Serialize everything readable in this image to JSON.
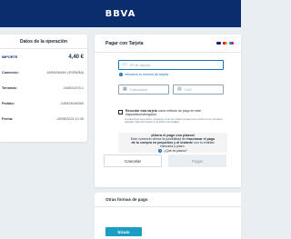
{
  "header": {
    "logo_text": "BBVA"
  },
  "operation": {
    "title": "Datos de la operación",
    "rows": [
      {
        "label": "IMPORTE",
        "value": "4,40 €"
      },
      {
        "label": "Comercio:",
        "value": "JARDINWAY (ESPAÑA)"
      },
      {
        "label": "Terminal:",
        "value": "264031979-1"
      },
      {
        "label": "Pedido:",
        "value": "240829046560"
      },
      {
        "label": "Fecha:",
        "value": "29/08/2024  12:30"
      }
    ]
  },
  "card_payment": {
    "title": "Pagar con Tarjeta",
    "card_number_placeholder": "Nº de tarjeta",
    "card_number_hint": "Introduce tu número de tarjeta",
    "expiry_placeholder": "Caducidad",
    "cvv_placeholder": "CVV",
    "remember_label_bold": "Recordar esta tarjeta",
    "remember_label_rest": "como método de pago en este dispositivo/navegador.",
    "legal_text": "Al seleccionar esta opción, consiente el uso de cookies propias para cumplir con la normativa aplicable. Más información en la Política de",
    "legal_link": "Cookies",
    "plazos_title": "¡Ahora el pago con plazos!",
    "plazos_text_pre": "Este comercio ofrece la posibilidad de",
    "plazos_text_bold1": "fraccionar el pago de tu compra en pequeños y al instante",
    "plazos_text_post": "con tu entidad bancaria y plazo.",
    "plazos_question": "¿Qué es plazos?",
    "cancel_label": "Cancelar",
    "pay_label": "Pagar"
  },
  "other_methods": {
    "title": "Otras formas de pago",
    "bizum_label": "bizum"
  },
  "colors": {
    "brand_navy": "#0a2d6e",
    "accent_blue": "#1973b8",
    "bizum": "#1c9ec4"
  }
}
